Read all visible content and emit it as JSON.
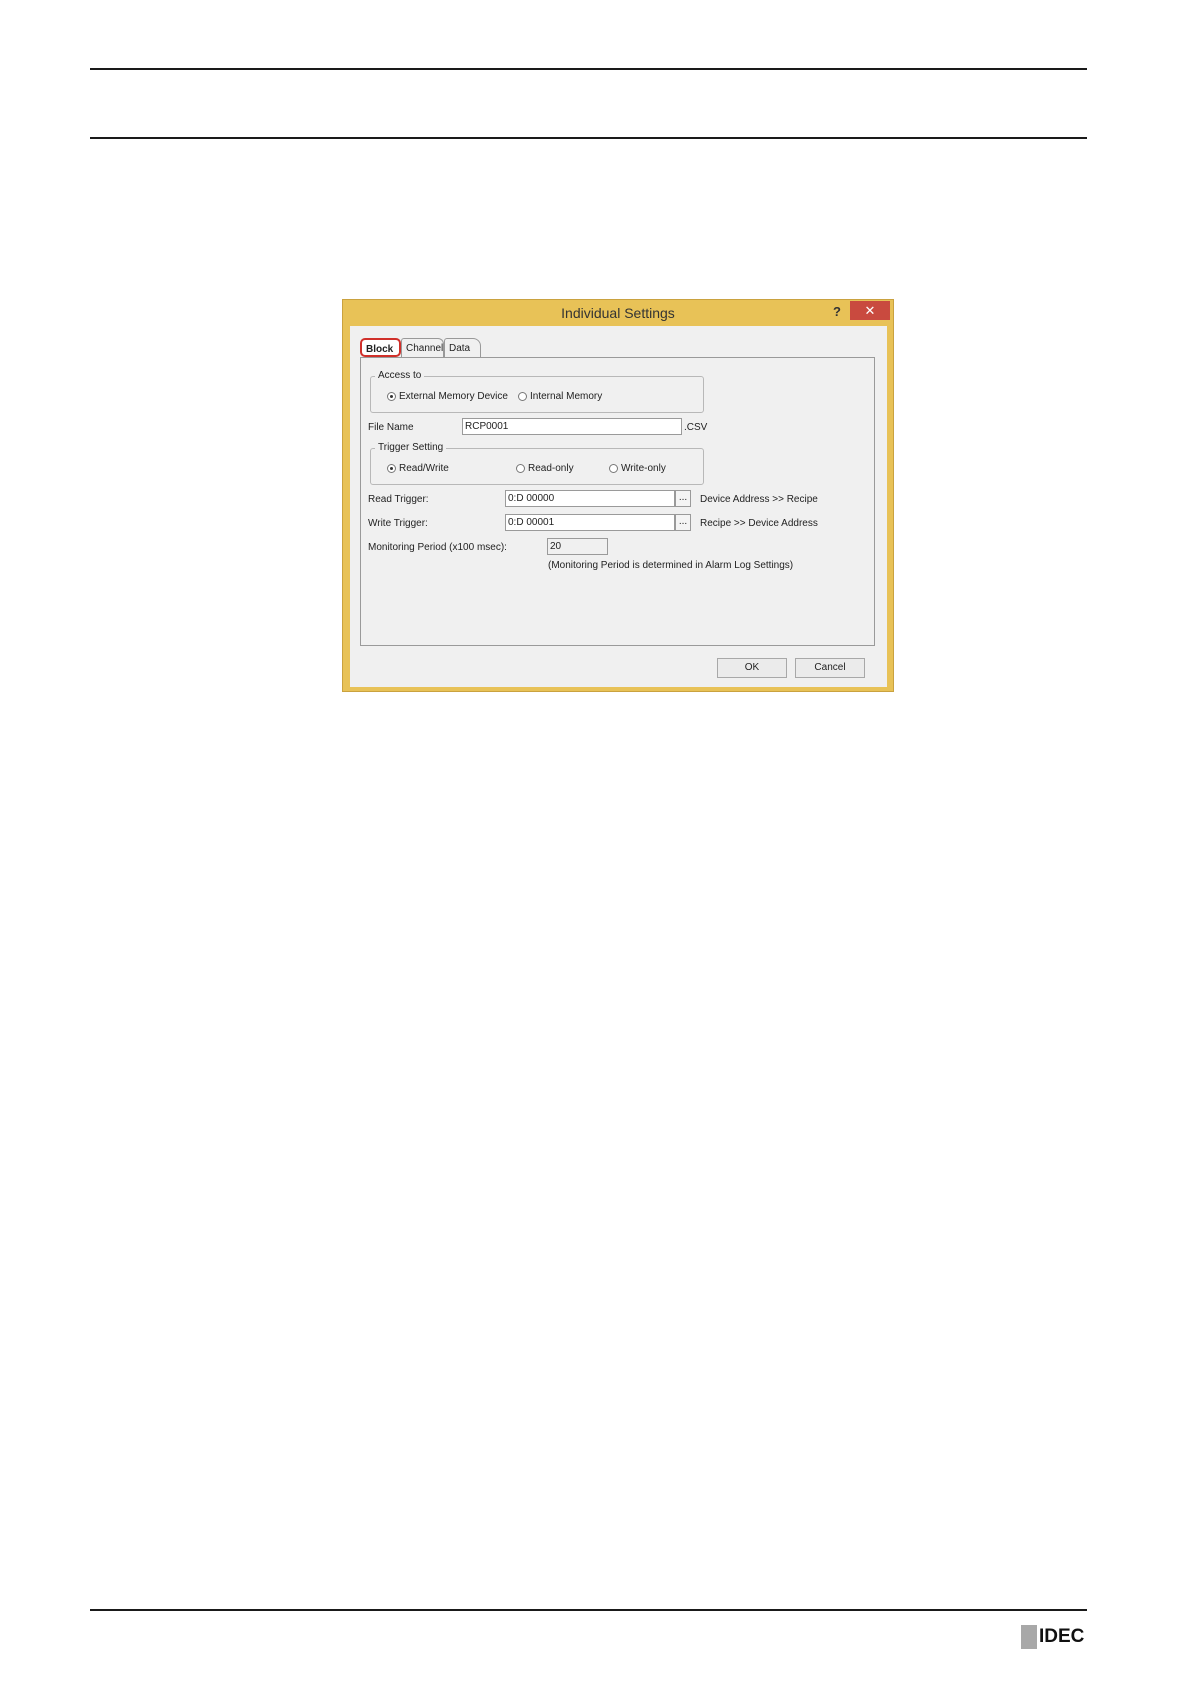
{
  "dialog": {
    "title": "Individual Settings",
    "help_label": "?",
    "close_label": "✕",
    "tabs": [
      "Block",
      "Channel",
      "Data"
    ],
    "access_to": {
      "group_label": "Access to",
      "options": [
        "External Memory Device",
        "Internal Memory"
      ],
      "selected": "External Memory Device"
    },
    "file_name": {
      "label": "File Name",
      "value": "RCP0001",
      "extension": ".CSV"
    },
    "trigger_setting": {
      "group_label": "Trigger Setting",
      "options": [
        "Read/Write",
        "Read-only",
        "Write-only"
      ],
      "selected": "Read/Write"
    },
    "read_trigger": {
      "label": "Read Trigger:",
      "value": "0:D 00000",
      "browse_label": "...",
      "note": "Device Address >> Recipe"
    },
    "write_trigger": {
      "label": "Write Trigger:",
      "value": "0:D 00001",
      "browse_label": "...",
      "note": "Recipe >> Device Address"
    },
    "monitoring_period": {
      "label": "Monitoring Period (x100 msec):",
      "value": "20",
      "note": "(Monitoring Period is determined in Alarm Log Settings)"
    },
    "ok_label": "OK",
    "cancel_label": "Cancel"
  },
  "footer": {
    "logo_text": "IDEC"
  }
}
